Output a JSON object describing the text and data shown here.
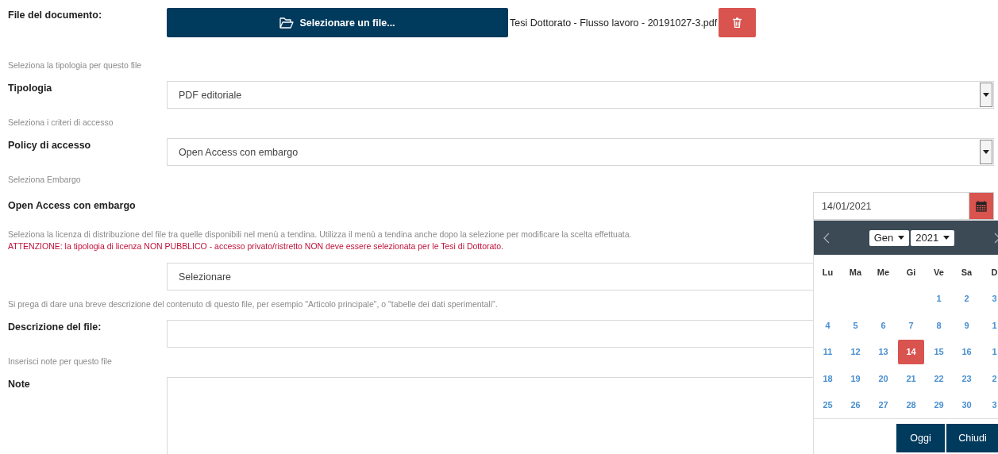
{
  "file": {
    "label": "File del documento:",
    "button": "Selezionare un file...",
    "filename": "Tesi Dottorato - Flusso lavoro - 20191027-3.pdf"
  },
  "sections": [
    {
      "kind": "select",
      "hint": "Seleziona la tipologia per questo file",
      "label": "Tipologia",
      "value": "PDF editoriale",
      "arrow": true
    },
    {
      "kind": "select",
      "hint": "Seleziona i criteri di accesso",
      "label": "Policy di accesso",
      "value": "Open Access con embargo",
      "arrow": true
    },
    {
      "kind": "date",
      "hint": "Seleziona Embargo",
      "label": "Open Access con embargo",
      "value": "14/01/2021"
    },
    {
      "kind": "select",
      "hint": "Seleziona la licenza di distribuzione del file tra quelle disponibili nel menù a tendina. Utilizza il menù a tendina anche dopo la selezione per modificare la scelta effettuata.",
      "warning": "ATTENZIONE: la tipologia di licenza NON PUBBLICO - accesso privato/ristretto NON deve essere selezionata per le Tesi di Dottorato.",
      "value": "Selezionare"
    },
    {
      "kind": "text",
      "hint": "Si prega di dare una breve descrizione del contenuto di questo file, per esempio \"Articolo principale\", o \"tabelle dei dati sperimentali\".",
      "label": "Descrizione del file:"
    },
    {
      "kind": "textarea",
      "hint": "Inserisci note per questo file",
      "label": "Note"
    }
  ],
  "datepicker": {
    "month": "Gen",
    "year": "2021",
    "weekdays": [
      "Lu",
      "Ma",
      "Me",
      "Gi",
      "Ve",
      "Sa",
      "D"
    ],
    "weeks": [
      [
        {
          "day": "1",
          "selected": false
        },
        {
          "day": "2",
          "selected": false
        },
        {
          "day": "3",
          "selected": false
        }
      ],
      [
        {
          "day": "4",
          "selected": false
        },
        {
          "day": "5",
          "selected": false
        },
        {
          "day": "6",
          "selected": false
        },
        {
          "day": "7",
          "selected": false
        },
        {
          "day": "8",
          "selected": false
        },
        {
          "day": "9",
          "selected": false
        },
        {
          "day": "1",
          "selected": false
        }
      ],
      [
        {
          "day": "11",
          "selected": false
        },
        {
          "day": "12",
          "selected": false
        },
        {
          "day": "13",
          "selected": false
        },
        {
          "day": "14",
          "selected": true
        },
        {
          "day": "15",
          "selected": false
        },
        {
          "day": "16",
          "selected": false
        },
        {
          "day": "1",
          "selected": false
        }
      ],
      [
        {
          "day": "18",
          "selected": false
        },
        {
          "day": "19",
          "selected": false
        },
        {
          "day": "20",
          "selected": false
        },
        {
          "day": "21",
          "selected": false
        },
        {
          "day": "22",
          "selected": false
        },
        {
          "day": "23",
          "selected": false
        },
        {
          "day": "2",
          "selected": false
        }
      ],
      [
        {
          "day": "25",
          "selected": false
        },
        {
          "day": "26",
          "selected": false
        },
        {
          "day": "27",
          "selected": false
        },
        {
          "day": "28",
          "selected": false
        },
        {
          "day": "29",
          "selected": false
        },
        {
          "day": "30",
          "selected": false
        },
        {
          "day": "3",
          "selected": false
        }
      ]
    ],
    "buttons": [
      "Oggi",
      "Chiudi"
    ]
  }
}
